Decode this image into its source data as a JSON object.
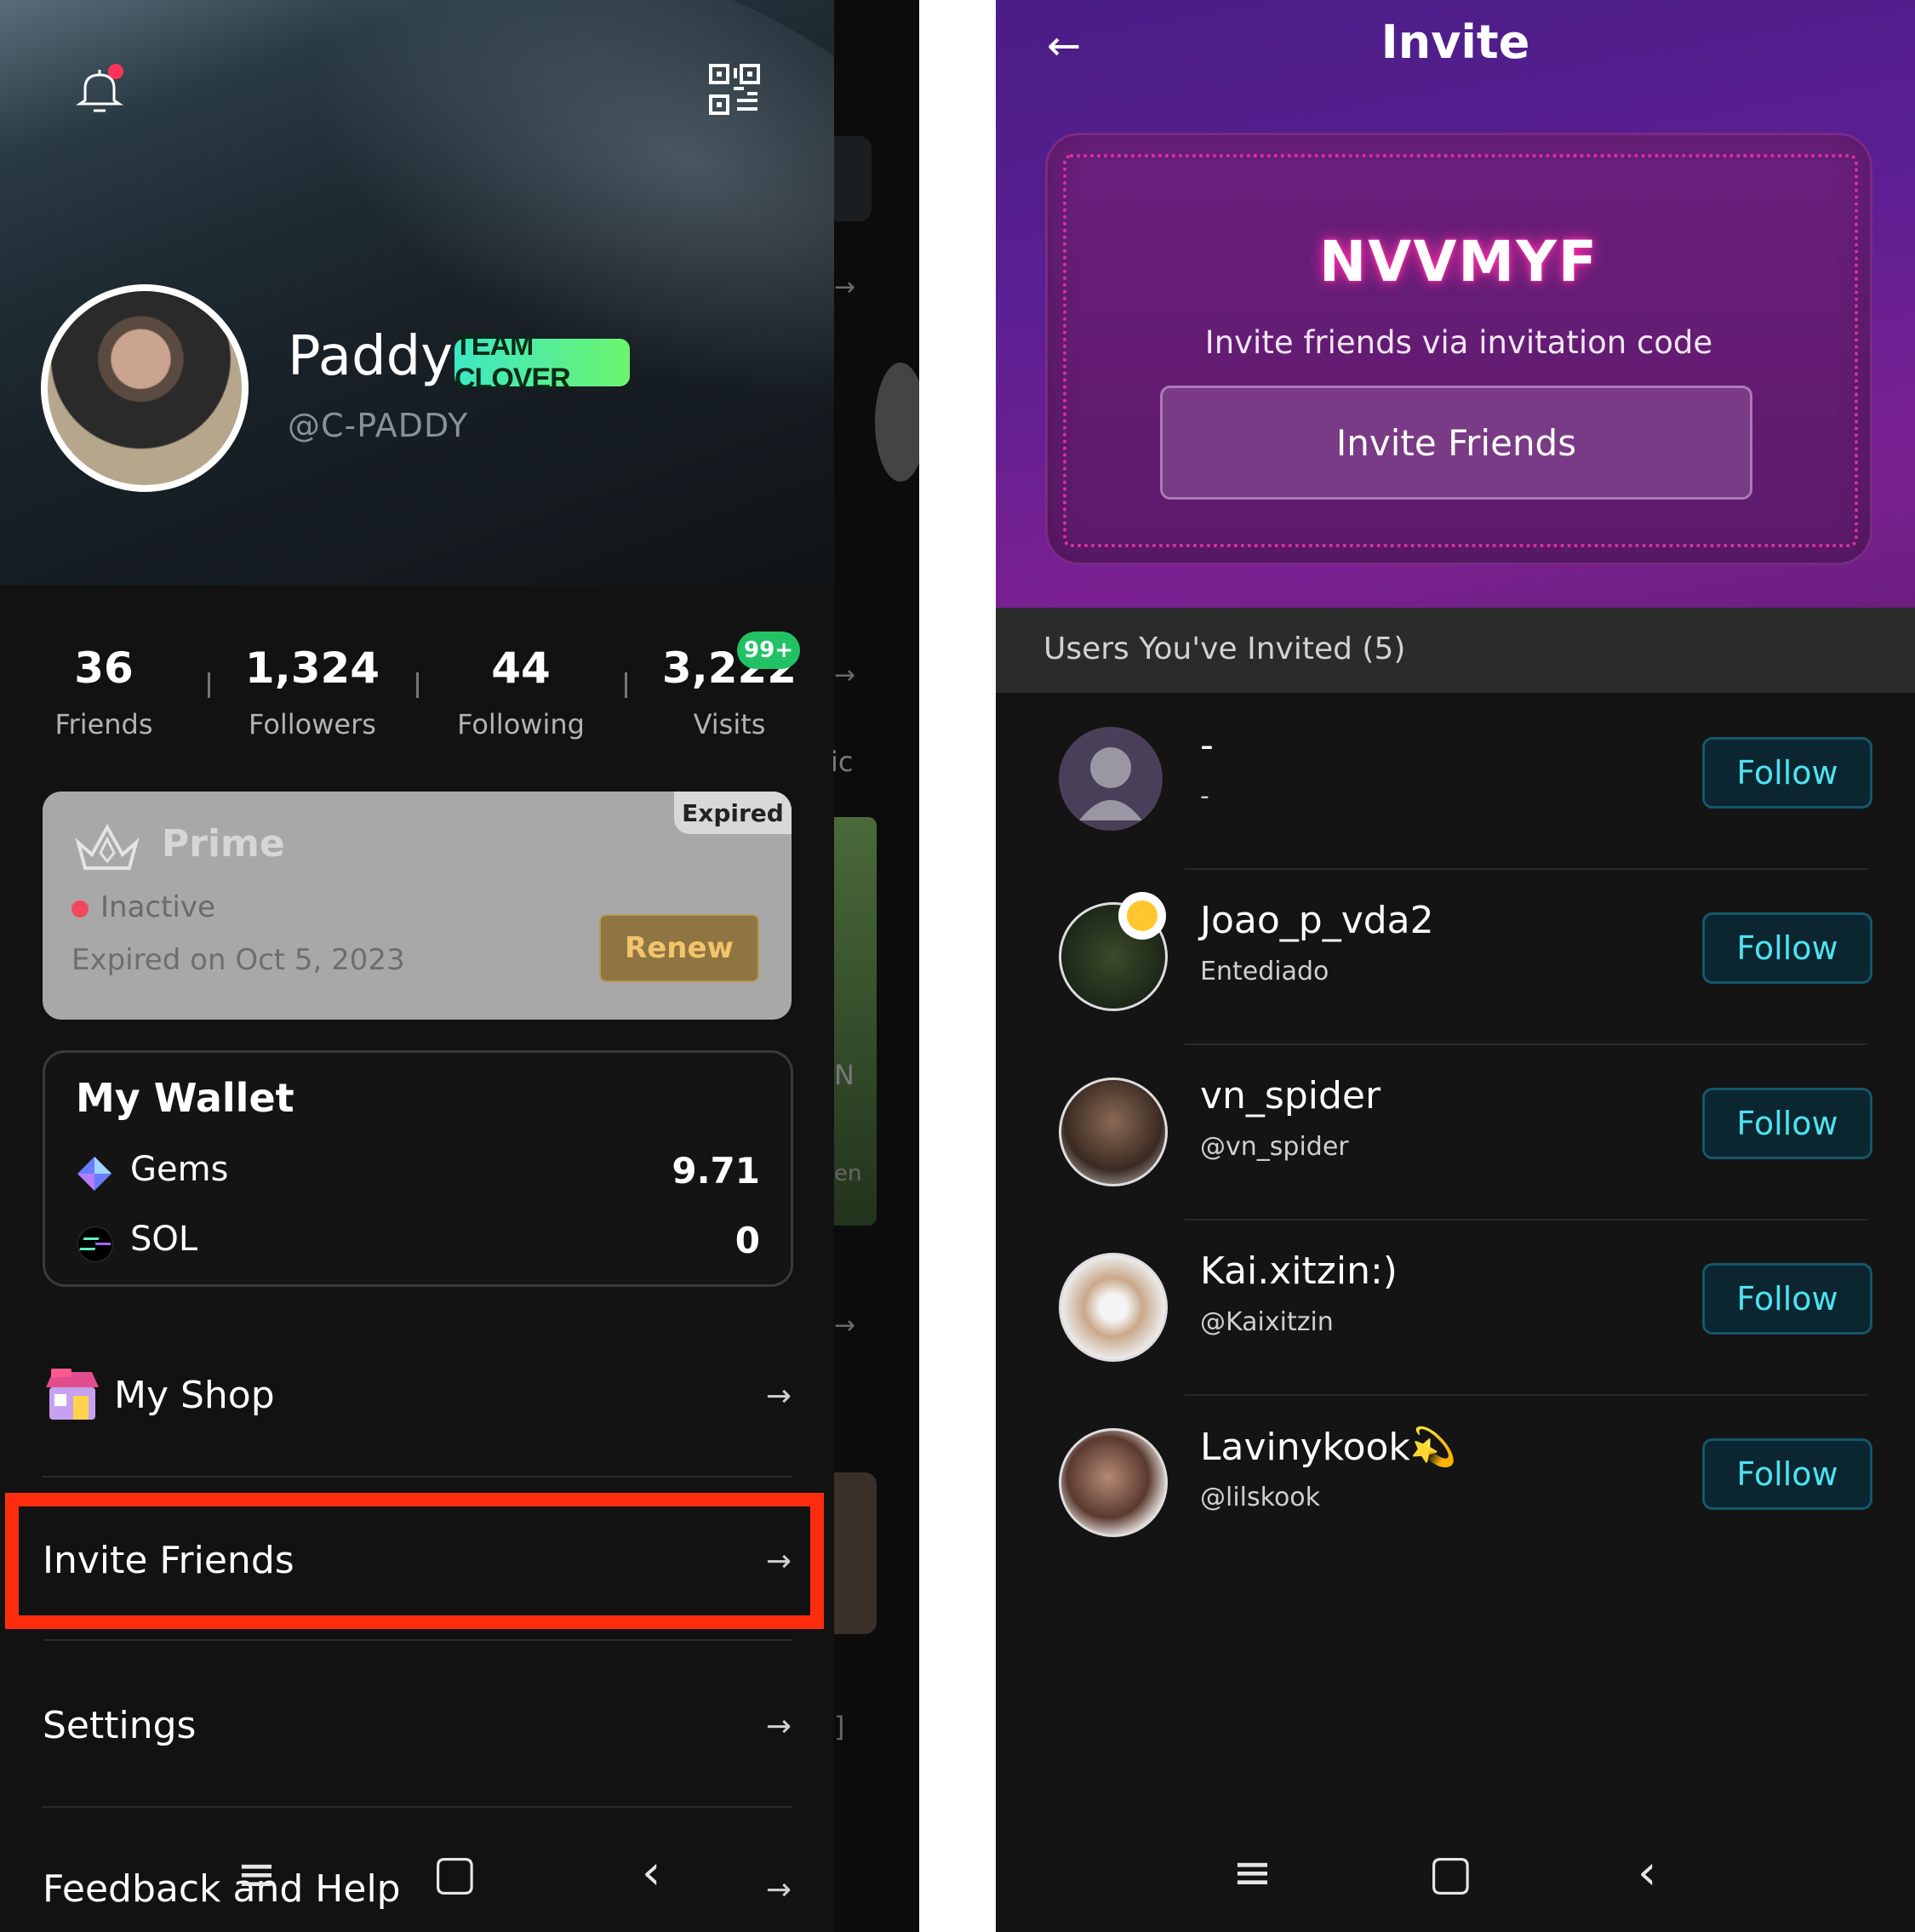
{
  "left": {
    "profile": {
      "name": "Paddy",
      "team_badge": "TEAM CLOVER",
      "handle": "@C-PADDY"
    },
    "stats": [
      {
        "value": "36",
        "label": "Friends"
      },
      {
        "value": "1,324",
        "label": "Followers"
      },
      {
        "value": "44",
        "label": "Following"
      },
      {
        "value": "3,222",
        "label": "Visits"
      }
    ],
    "visits_badge": "99+",
    "prime": {
      "title": "Prime",
      "corner_tag": "Expired",
      "status": "Inactive",
      "expired_text": "Expired on Oct 5, 2023",
      "renew_label": "Renew"
    },
    "wallet": {
      "title": "My Wallet",
      "items": [
        {
          "label": "Gems",
          "value": "9.71",
          "icon": "gem-icon"
        },
        {
          "label": "SOL",
          "value": "0",
          "icon": "sol-icon"
        }
      ]
    },
    "menu": [
      {
        "label": "My Shop",
        "icon": "shop-icon"
      },
      {
        "label": "Invite Friends"
      },
      {
        "label": "Settings"
      },
      {
        "label": "Feedback and Help"
      }
    ],
    "arrow": "→",
    "peek_fragments": [
      "ic",
      "N",
      "en",
      "]"
    ],
    "highlight_color": "#ff2d0e"
  },
  "right": {
    "title": "Invite",
    "back_icon": "←",
    "invite_code": "NVVMYF",
    "code_caption": "Invite friends via invitation code",
    "invite_button": "Invite Friends",
    "section_title": "Users You've Invited (5)",
    "users": [
      {
        "name": "-",
        "sub": "-",
        "follow": "Follow"
      },
      {
        "name": "Joao_p_vda2",
        "sub": "Entediado",
        "follow": "Follow"
      },
      {
        "name": "vn_spider",
        "sub": "@vn_spider",
        "follow": "Follow"
      },
      {
        "name": "Kai.xitzin:)",
        "sub": "@Kaixitzin",
        "follow": "Follow"
      },
      {
        "name": "Lavinykook💫",
        "sub": "@lilskook",
        "follow": "Follow"
      }
    ],
    "accent": "#4de3f0"
  },
  "navbar": {
    "menu_icon": "≡",
    "home_icon": "▢",
    "back_icon": "‹"
  }
}
